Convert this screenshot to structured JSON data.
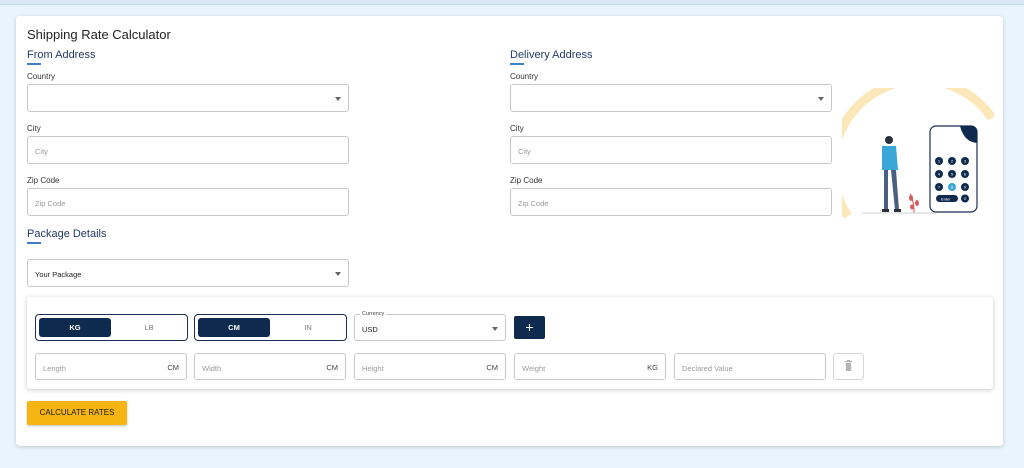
{
  "page": {
    "title": "Shipping Rate Calculator"
  },
  "from": {
    "heading": "From Address",
    "country_label": "Country",
    "country_value": "",
    "city_label": "City",
    "city_placeholder": "City",
    "zip_label": "Zip Code",
    "zip_placeholder": "Zip Code"
  },
  "delivery": {
    "heading": "Delivery Address",
    "country_label": "Country",
    "country_value": "",
    "city_label": "City",
    "city_placeholder": "City",
    "zip_label": "Zip Code",
    "zip_placeholder": "Zip Code"
  },
  "package": {
    "heading": "Package Details",
    "select_value": "Your Package",
    "weight_units": {
      "selected": "KG",
      "other": "LB"
    },
    "dim_units": {
      "selected": "CM",
      "other": "IN"
    },
    "currency_label": "Currency",
    "currency_value": "USD",
    "add_label": "+",
    "fields": [
      {
        "placeholder": "Length",
        "unit": "CM"
      },
      {
        "placeholder": "Width",
        "unit": "CM"
      },
      {
        "placeholder": "Height",
        "unit": "CM"
      },
      {
        "placeholder": "Weight",
        "unit": "KG"
      },
      {
        "placeholder": "Declared Value",
        "unit": ""
      }
    ]
  },
  "illustration": {
    "keypad_keys": [
      "1",
      "2",
      "3",
      "4",
      "5",
      "6",
      "7",
      "8",
      "9"
    ],
    "enter_label": "Enter",
    "zero_label": "0"
  },
  "actions": {
    "calculate_label": "CALCULATE RATES"
  },
  "colors": {
    "navy": "#0f2a4f",
    "accent_blue": "#3b7fc4",
    "button_yellow": "#f6b512",
    "background": "#e9f5fc"
  },
  "icons": {
    "dropdown": "chevron-down-icon",
    "add": "plus-icon",
    "delete": "trash-icon"
  }
}
